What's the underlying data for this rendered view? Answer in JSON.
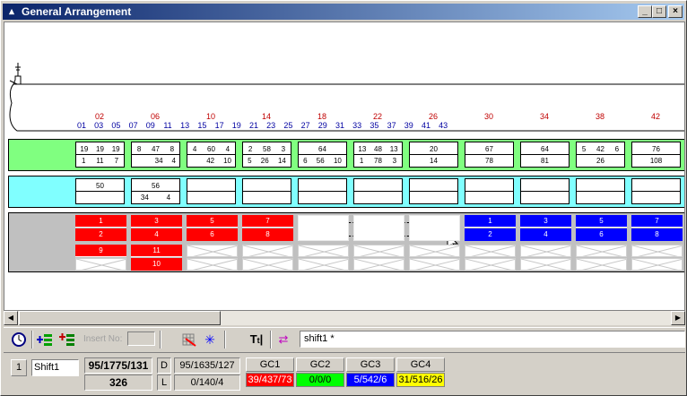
{
  "window": {
    "title": "General Arrangement",
    "minimize": "_",
    "maximize": "□",
    "close": "×"
  },
  "frames": {
    "top": [
      "02",
      "06",
      "10",
      "14",
      "18",
      "22",
      "26",
      "30",
      "34",
      "38",
      "42"
    ],
    "bottom": [
      "01",
      "03",
      "05",
      "07",
      "09",
      "11",
      "13",
      "15",
      "17",
      "19",
      "21",
      "23",
      "25",
      "27",
      "29",
      "31",
      "33",
      "35",
      "37",
      "39",
      "41",
      "43"
    ]
  },
  "tanks": [
    {
      "r1": [
        "19",
        "19",
        "19"
      ],
      "r2": [
        "1",
        "11",
        "7"
      ]
    },
    {
      "r1": [
        "8",
        "47",
        "8"
      ],
      "r2": [
        "34",
        "4"
      ]
    },
    {
      "r1": [
        "4",
        "60",
        "4"
      ],
      "r2": [
        "42",
        "10"
      ]
    },
    {
      "r1": [
        "2",
        "58",
        "3"
      ],
      "r2": [
        "5",
        "26",
        "14"
      ]
    },
    {
      "r1": [
        "64"
      ],
      "r2": [
        "6",
        "56",
        "10"
      ]
    },
    {
      "r1": [
        "13",
        "48",
        "13"
      ],
      "r2": [
        "1",
        "78",
        "3"
      ]
    },
    {
      "r1": [
        "20"
      ],
      "r2": [
        "14"
      ]
    },
    {
      "r1": [
        "67"
      ],
      "r2": [
        "78"
      ]
    },
    {
      "r1": [
        "64"
      ],
      "r2": [
        "81"
      ]
    },
    {
      "r1": [
        "5",
        "42",
        "6"
      ],
      "r2": [
        "26"
      ]
    },
    {
      "r1": [
        "76"
      ],
      "r2": [
        "108"
      ]
    }
  ],
  "deck": [
    {
      "r1": [
        "50"
      ],
      "r2": []
    },
    {
      "r1": [
        "56"
      ],
      "r2": [
        "34",
        "4"
      ]
    },
    {
      "r1": [],
      "r2": []
    },
    {
      "r1": [],
      "r2": []
    },
    {
      "r1": [],
      "r2": []
    },
    {
      "r1": [],
      "r2": []
    },
    {
      "r1": [],
      "r2": []
    },
    {
      "r1": [],
      "r2": []
    },
    {
      "r1": [],
      "r2": []
    },
    {
      "r1": [],
      "r2": []
    },
    {
      "r1": [],
      "r2": []
    }
  ],
  "holds_upper": [
    {
      "top": "1",
      "bot": "2",
      "color": "red"
    },
    {
      "top": "3",
      "bot": "4",
      "color": "red"
    },
    {
      "top": "5",
      "bot": "6",
      "color": "red"
    },
    {
      "top": "7",
      "bot": "8",
      "color": "red"
    },
    null,
    null,
    null,
    {
      "top": "1",
      "bot": "2",
      "color": "blue"
    },
    {
      "top": "3",
      "bot": "4",
      "color": "blue"
    },
    {
      "top": "5",
      "bot": "6",
      "color": "blue"
    },
    {
      "top": "7",
      "bot": "8",
      "color": "blue"
    }
  ],
  "holds_lower": [
    {
      "top": "9",
      "bot": null,
      "color": "red"
    },
    {
      "top": "11",
      "bot": "10",
      "color": "red"
    }
  ],
  "toolbar": {
    "insert_label": "Insert No:",
    "shift_field": "shift1 *"
  },
  "status": {
    "index": "1",
    "shift_name": "Shift1",
    "total_top": "95/1775/131",
    "total_bottom": "326",
    "d_label": "D",
    "d_value": "95/1635/127",
    "l_label": "L",
    "l_value": "0/140/4",
    "gc": [
      {
        "label": "GC1",
        "value": "39/437/73",
        "color": "#ff0000",
        "text": "#ffffff"
      },
      {
        "label": "GC2",
        "value": "0/0/0",
        "color": "#00ff00",
        "text": "#000000"
      },
      {
        "label": "GC3",
        "value": "5/542/6",
        "color": "#0000ff",
        "text": "#ffffff"
      },
      {
        "label": "GC4",
        "value": "31/516/26",
        "color": "#ffff00",
        "text": "#000000"
      }
    ]
  },
  "colors": {
    "tank_band": "#80ff80",
    "deck_band": "#80ffff",
    "hold_band": "#c0c0c0",
    "red": "#ff0000",
    "blue": "#0000ff"
  }
}
